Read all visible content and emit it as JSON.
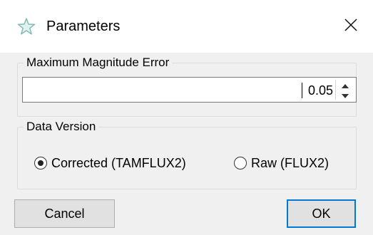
{
  "window": {
    "title": "Parameters",
    "icon": "star-icon",
    "close_icon": "close-icon",
    "accent_color": "#0078d7"
  },
  "magnitude": {
    "label": "Maximum Magnitude Error",
    "value": "0.05"
  },
  "data_version": {
    "label": "Data Version",
    "options": [
      {
        "label": "Corrected (TAMFLUX2)",
        "selected": true
      },
      {
        "label": "Raw (FLUX2)",
        "selected": false
      }
    ]
  },
  "buttons": {
    "cancel": "Cancel",
    "ok": "OK"
  }
}
